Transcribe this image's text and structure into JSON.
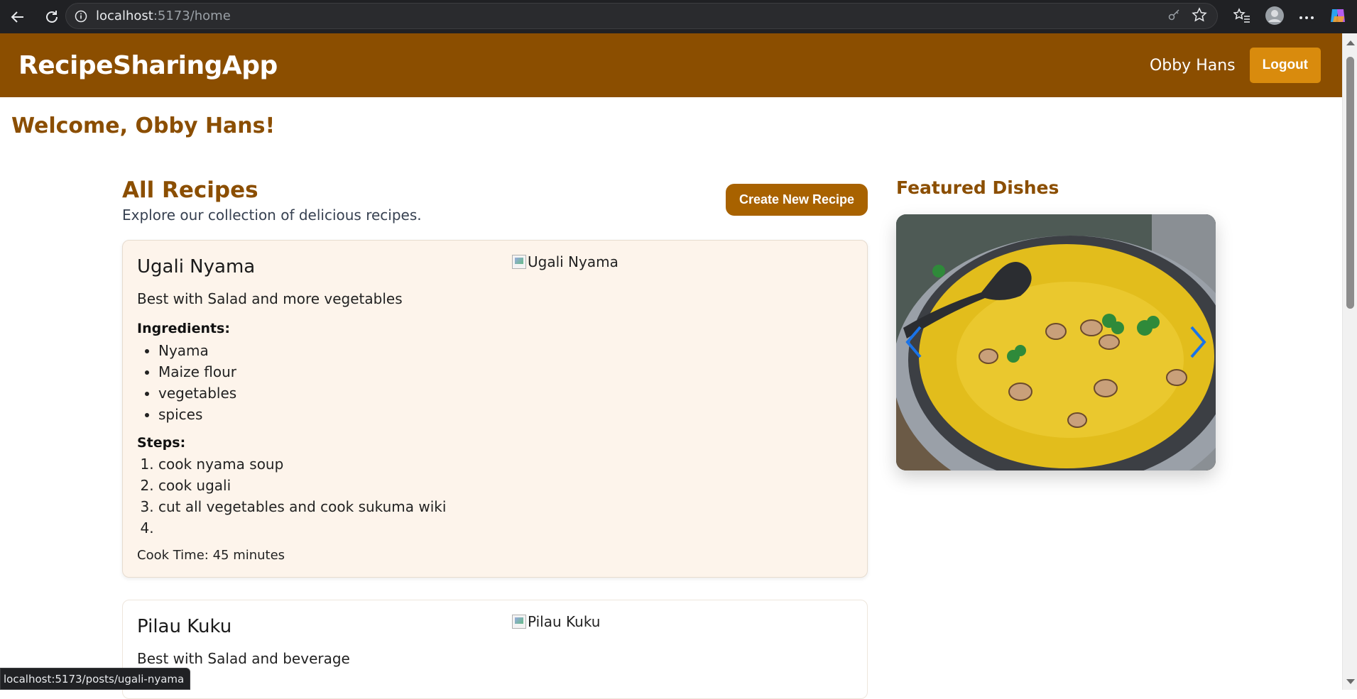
{
  "browser": {
    "url_host": "localhost",
    "url_path": ":5173/home"
  },
  "header": {
    "brand": "RecipeSharingApp",
    "user_name": "Obby Hans",
    "logout_label": "Logout"
  },
  "welcome": "Welcome, Obby Hans!",
  "recipes_section": {
    "title": "All Recipes",
    "subtitle": "Explore our collection of delicious recipes.",
    "create_label": "Create New Recipe"
  },
  "recipes": [
    {
      "title": "Ugali Nyama",
      "description": "Best with Salad and more vegetables",
      "image_alt": "Ugali Nyama",
      "ingredients_label": "Ingredients:",
      "ingredients": [
        "Nyama",
        "Maize flour",
        "vegetables",
        "spices"
      ],
      "steps_label": "Steps:",
      "steps": [
        "cook nyama soup",
        "cook ugali",
        "cut all vegetables and cook sukuma wiki",
        ""
      ],
      "cook_time": "Cook Time: 45 minutes"
    },
    {
      "title": "Pilau Kuku",
      "description": "Best with Salad and beverage",
      "image_alt": "Pilau Kuku"
    }
  ],
  "featured": {
    "title": "Featured Dishes"
  },
  "status_tip": "localhost:5173/posts/ugali-nyama",
  "colors": {
    "brand": "#8b4e00",
    "accent": "#d98b0d",
    "card_bg": "#fdf4eb",
    "carousel_arrow": "#1a73e8"
  }
}
